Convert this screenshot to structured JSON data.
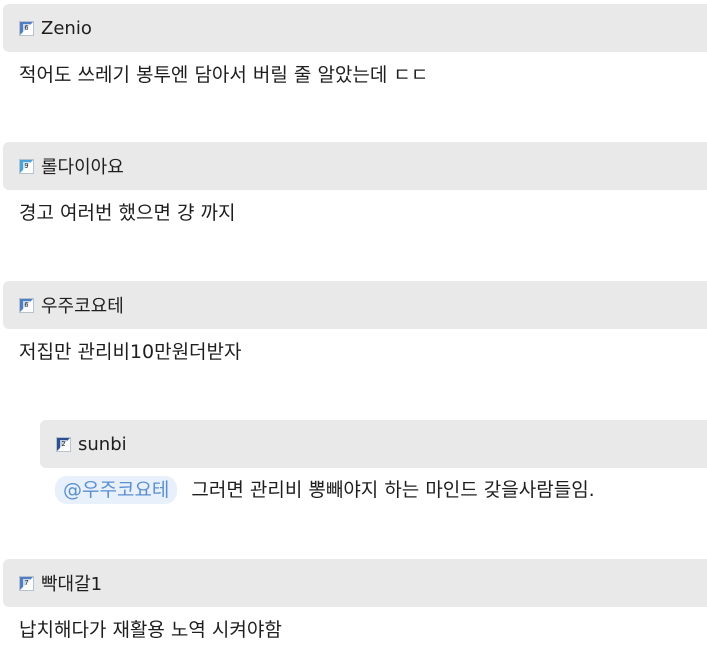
{
  "comments": [
    {
      "nickname": "Zenio",
      "level": "6",
      "level_color": "#4f7fc2",
      "body": "적어도 쓰레기 봉투엔 담아서 버릴 줄 알았는데 ㄷㄷ"
    },
    {
      "nickname": "롤다이아요",
      "level": "9",
      "level_color": "#4aa3d8",
      "body": "경고 여러번 했으면 걍 까지"
    },
    {
      "nickname": "우주코요테",
      "level": "6",
      "level_color": "#4f7fc2",
      "body": "저집만 관리비10만원더받자"
    },
    {
      "nickname": "sunbi",
      "level": "2",
      "level_color": "#2d4f8e",
      "mention": "@우주코요테",
      "body": "그러면 관리비 뽕빼야지 하는 마인드 갖을사람들임."
    },
    {
      "nickname": "빡대갈1",
      "level": "7",
      "level_color": "#4f7fc2",
      "body": "납치해다가 재활용 노역 시켜야함"
    }
  ]
}
